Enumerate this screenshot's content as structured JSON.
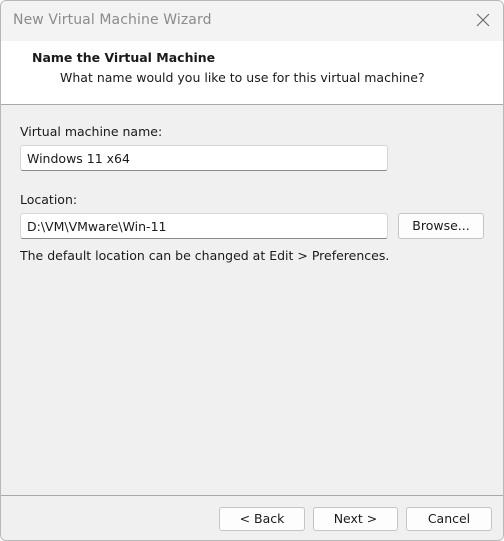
{
  "window": {
    "title": "New Virtual Machine Wizard",
    "close_icon": "close-icon"
  },
  "header": {
    "title": "Name the Virtual Machine",
    "subtitle": "What name would you like to use for this virtual machine?"
  },
  "form": {
    "vm_name_label": "Virtual machine name:",
    "vm_name_value": "Windows 11 x64",
    "location_label": "Location:",
    "location_value": "D:\\VM\\VMware\\Win-11",
    "browse_label": "Browse...",
    "note": "The default location can be changed at Edit > Preferences."
  },
  "footer": {
    "back_label": "< Back",
    "next_label": "Next >",
    "cancel_label": "Cancel"
  },
  "colors": {
    "window_bg": "#f0f0f0",
    "header_bg": "#ffffff",
    "title_text": "#8b8b8b"
  }
}
